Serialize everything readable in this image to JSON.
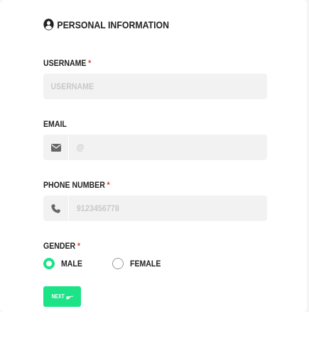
{
  "section": {
    "title": "Personal Information",
    "icon": "user-circle-icon"
  },
  "username": {
    "label": "Username",
    "required_mark": "*",
    "placeholder": "Username"
  },
  "email": {
    "label": "Email",
    "placeholder": "@",
    "icon": "envelope-icon"
  },
  "phone": {
    "label": "Phone Number",
    "required_mark": "*",
    "placeholder": "9123456778",
    "icon": "phone-icon"
  },
  "gender": {
    "label": "Gender",
    "required_mark": "*",
    "options": [
      {
        "label": "Male",
        "checked": true
      },
      {
        "label": "Female",
        "checked": false
      }
    ]
  },
  "next_button": {
    "label": "Next",
    "icon": "pointing-hand-icon"
  },
  "colors": {
    "accent": "#1be386",
    "required": "#d0463b",
    "input_bg": "#f2f2f2"
  }
}
